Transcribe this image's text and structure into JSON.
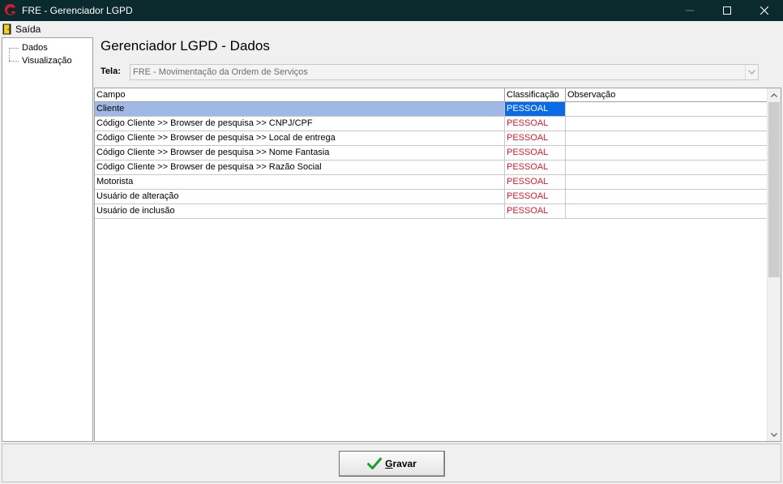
{
  "window": {
    "title": "FRE - Gerenciador LGPD",
    "logo_icon": "g-logo-icon",
    "controls": [
      "minimize-icon",
      "maximize-icon",
      "close-icon"
    ]
  },
  "menu": {
    "items": [
      {
        "label": "Saída",
        "icon": "door-exit-icon"
      }
    ]
  },
  "tree": {
    "items": [
      {
        "label": "Dados"
      },
      {
        "label": "Visualização"
      }
    ]
  },
  "main": {
    "title": "Gerenciador LGPD - Dados",
    "tela_label": "Tela:",
    "tela_value": "FRE - Movimentação da Ordem de Serviços"
  },
  "grid": {
    "columns": [
      "Campo",
      "Classificação",
      "Observação"
    ],
    "rows": [
      {
        "campo": "Cliente",
        "classificacao": "PESSOAL",
        "observacao": "",
        "selected": true
      },
      {
        "campo": "Código Cliente >> Browser de pesquisa >> CNPJ/CPF",
        "classificacao": "PESSOAL",
        "observacao": ""
      },
      {
        "campo": "Código Cliente >> Browser de pesquisa >> Local de entrega",
        "classificacao": "PESSOAL",
        "observacao": ""
      },
      {
        "campo": "Código Cliente >> Browser de pesquisa >> Nome Fantasia",
        "classificacao": "PESSOAL",
        "observacao": ""
      },
      {
        "campo": "Código Cliente >> Browser de pesquisa >> Razão Social",
        "classificacao": "PESSOAL",
        "observacao": ""
      },
      {
        "campo": "Motorista",
        "classificacao": "PESSOAL",
        "observacao": ""
      },
      {
        "campo": "Usuário de alteração",
        "classificacao": "PESSOAL",
        "observacao": ""
      },
      {
        "campo": "Usuário de inclusão",
        "classificacao": "PESSOAL",
        "observacao": ""
      }
    ]
  },
  "footer": {
    "save_mnemonic": "G",
    "save_rest": "ravar",
    "save_icon": "checkmark-icon"
  },
  "colors": {
    "titlebar": "#0b2a2d",
    "selection_row": "#9fb9e6",
    "selection_cell": "#0a6be8",
    "classification_text": "#e0192b",
    "check_green": "#1e9e2e"
  }
}
